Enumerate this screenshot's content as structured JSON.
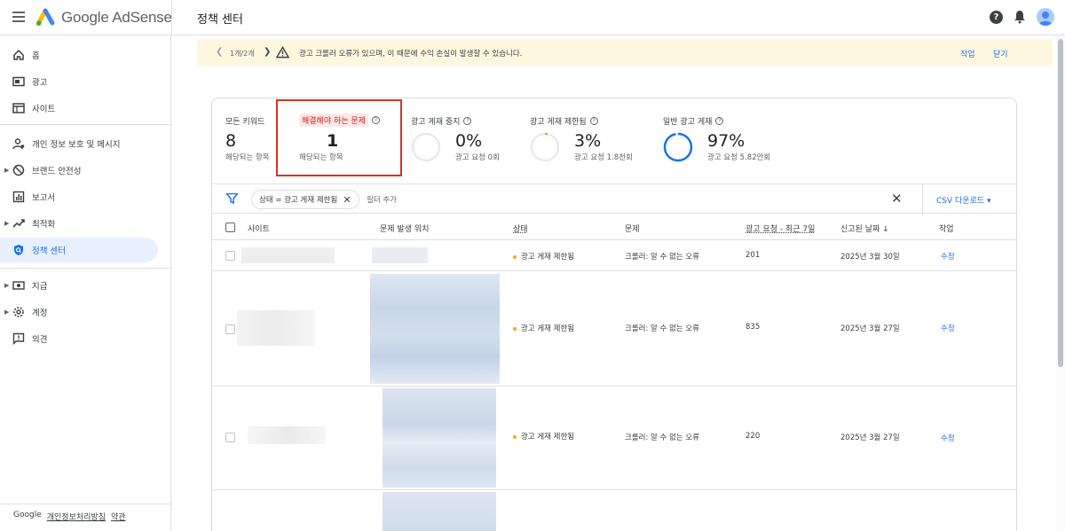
{
  "app": {
    "brand": "Google AdSense",
    "page_title": "정책 센터"
  },
  "sidebar": {
    "items": [
      {
        "label": "홈",
        "icon": "home-icon"
      },
      {
        "label": "광고",
        "icon": "ads-icon"
      },
      {
        "label": "사이트",
        "icon": "sites-icon"
      },
      {
        "label": "개인 정보 보호 및 메시지",
        "icon": "privacy-icon"
      },
      {
        "label": "브랜드 안전성",
        "icon": "block-icon"
      },
      {
        "label": "보고서",
        "icon": "reports-icon"
      },
      {
        "label": "최적화",
        "icon": "optimize-icon"
      },
      {
        "label": "정책 센터",
        "icon": "policy-shield-icon"
      },
      {
        "label": "지급",
        "icon": "payments-icon"
      },
      {
        "label": "계정",
        "icon": "gear-icon"
      },
      {
        "label": "의견",
        "icon": "feedback-icon"
      }
    ],
    "active": "정책 센터",
    "footer": {
      "google": "Google",
      "privacy": "개인정보처리방침",
      "terms": "약관"
    }
  },
  "banner": {
    "count": "1개/2개",
    "message": "광고 크롤러 오류가 있으며, 이 때문에 수익 손실이 발생할 수 있습니다.",
    "action": "작업",
    "dismiss": "닫기"
  },
  "metrics": {
    "all_issues": {
      "title": "모든 키워드",
      "value": "8",
      "sub": "해당되는 항목"
    },
    "to_fix": {
      "title": "해결해야 하는 문제",
      "value": "1",
      "sub": "해당되는 항목"
    },
    "ad_serving_stopped": {
      "title": "광고 게재 중지",
      "value": "0%",
      "sub": "광고 요청 0회",
      "fraction": 0.0
    },
    "ad_serving_limited": {
      "title": "광고 게재 제한됨",
      "value": "3%",
      "sub": "광고 요청 1.8천회",
      "fraction": 0.03
    },
    "normal_serving": {
      "title": "일반 광고 게재",
      "value": "97%",
      "sub": "광고 요청 5.82만회",
      "fraction": 0.97
    }
  },
  "filter": {
    "chip": "상태 = 광고 게재 제한됨",
    "add": "필터 추가",
    "csv": "CSV 다운로드"
  },
  "table": {
    "headers": {
      "site": "사이트",
      "location": "문제 발생 위치",
      "status": "상태",
      "issue": "문제",
      "requests": "광고 요청 - 최근 7일",
      "reported": "신고된 날짜",
      "action": "작업"
    },
    "rows": [
      {
        "status": "광고 게재 제한됨",
        "issue": "크롤러: 알 수 없는 오류",
        "requests": "201",
        "date": "2025년 3월 30일",
        "action": "수정"
      },
      {
        "status": "광고 게재 제한됨",
        "issue": "크롤러: 알 수 없는 오류",
        "requests": "835",
        "date": "2025년 3월 27일",
        "action": "수정"
      },
      {
        "status": "광고 게재 제한됨",
        "issue": "크롤러: 알 수 없는 오류",
        "requests": "220",
        "date": "2025년 3월 27일",
        "action": "수정"
      }
    ]
  },
  "colors": {
    "accent": "#1a73e8",
    "warning": "#f9ab00",
    "highlight": "#d93025",
    "banner": "#fef7e0"
  }
}
